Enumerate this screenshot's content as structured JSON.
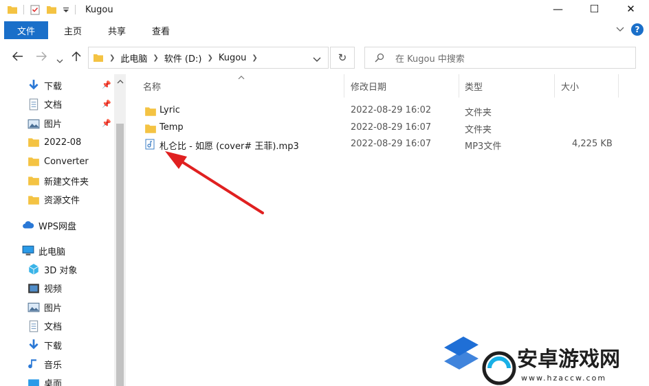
{
  "window": {
    "title": "Kugou",
    "minimize_glyph": "—",
    "maximize_glyph": "☐",
    "close_glyph": "✕"
  },
  "ribbon": {
    "tabs": [
      "文件",
      "主页",
      "共享",
      "查看"
    ],
    "help_label": "?"
  },
  "address": {
    "path": [
      "此电脑",
      "软件 (D:)",
      "Kugou"
    ],
    "search_placeholder": "在 Kugou 中搜索"
  },
  "sidebar": {
    "quick_access": [
      {
        "label": "下载",
        "icon": "download-icon",
        "pinned": true
      },
      {
        "label": "文档",
        "icon": "document-icon",
        "pinned": true
      },
      {
        "label": "图片",
        "icon": "picture-icon",
        "pinned": true
      },
      {
        "label": "2022-08",
        "icon": "folder-icon",
        "pinned": false
      },
      {
        "label": "Converter",
        "icon": "folder-icon",
        "pinned": false
      },
      {
        "label": "新建文件夹",
        "icon": "folder-icon",
        "pinned": false
      },
      {
        "label": "资源文件",
        "icon": "folder-icon",
        "pinned": false
      }
    ],
    "wps": {
      "label": "WPS网盘",
      "icon": "cloud-icon"
    },
    "this_pc": {
      "label": "此电脑",
      "icon": "computer-icon"
    },
    "pc_items": [
      {
        "label": "3D 对象",
        "icon": "cube-icon"
      },
      {
        "label": "视频",
        "icon": "video-icon"
      },
      {
        "label": "图片",
        "icon": "picture-icon"
      },
      {
        "label": "文档",
        "icon": "document-icon"
      },
      {
        "label": "下载",
        "icon": "download-icon"
      },
      {
        "label": "音乐",
        "icon": "music-icon"
      },
      {
        "label": "桌面",
        "icon": "desktop-icon"
      }
    ]
  },
  "columns": {
    "name": "名称",
    "date": "修改日期",
    "type": "类型",
    "size": "大小"
  },
  "files": [
    {
      "name": "Lyric",
      "date": "2022-08-29 16:02",
      "type": "文件夹",
      "size": "",
      "icon": "folder-icon"
    },
    {
      "name": "Temp",
      "date": "2022-08-29 16:07",
      "type": "文件夹",
      "size": "",
      "icon": "folder-icon"
    },
    {
      "name": "札仑比 - 如愿 (cover# 王菲).mp3",
      "date": "2022-08-29 16:07",
      "type": "MP3文件",
      "size": "4,225 KB",
      "icon": "mp3-file-icon"
    }
  ],
  "watermark": {
    "text": "安卓游戏网",
    "url": "www.hzaccw.com"
  },
  "colors": {
    "accent": "#1a6fc9",
    "folder": "#f4c343",
    "arrow": "#e02020"
  }
}
